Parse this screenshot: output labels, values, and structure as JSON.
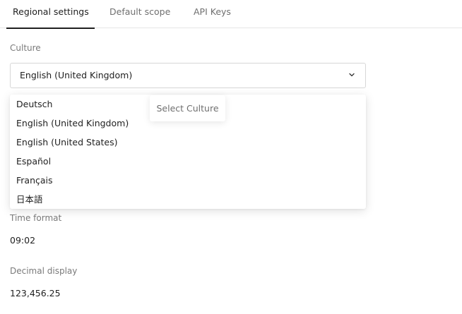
{
  "tabs": [
    {
      "label": "Regional settings",
      "active": true
    },
    {
      "label": "Default scope",
      "active": false
    },
    {
      "label": "API Keys",
      "active": false
    }
  ],
  "culture": {
    "label": "Culture",
    "selected": "English (United Kingdom)",
    "tooltip": "Select Culture",
    "options": [
      "Deutsch",
      "English (United Kingdom)",
      "English (United States)",
      "Español",
      "Français",
      "日本語"
    ]
  },
  "time_format": {
    "label": "Time format",
    "value": "09:02"
  },
  "decimal_display": {
    "label": "Decimal display",
    "value": "123,456.25"
  },
  "icons": {
    "dropdown_chevron": "chevron-down-icon"
  }
}
